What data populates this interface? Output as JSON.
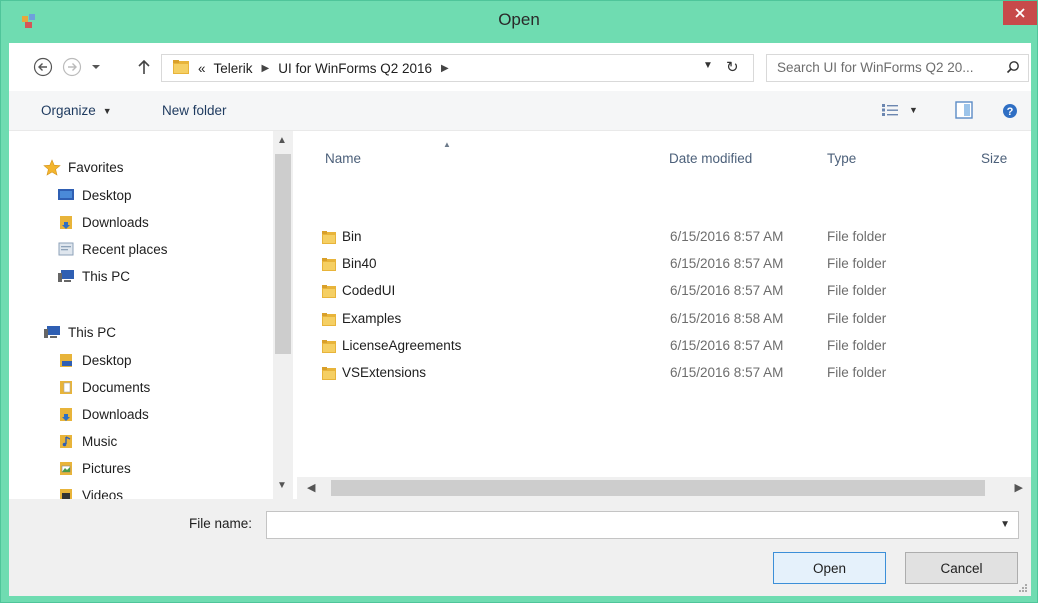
{
  "window": {
    "title": "Open",
    "colors": {
      "frame": "#6fdcb1",
      "close": "#c74a4a"
    }
  },
  "address": {
    "overflow": "«",
    "crumbs": [
      "Telerik",
      "UI for WinForms Q2 2016"
    ]
  },
  "search": {
    "placeholder": "Search UI for WinForms Q2 20..."
  },
  "toolbar": {
    "organize": "Organize",
    "new_folder": "New folder"
  },
  "nav": {
    "favorites": {
      "label": "Favorites",
      "items": [
        "Desktop",
        "Downloads",
        "Recent places",
        "This PC"
      ]
    },
    "this_pc": {
      "label": "This PC",
      "items": [
        "Desktop",
        "Documents",
        "Downloads",
        "Music",
        "Pictures",
        "Videos"
      ]
    }
  },
  "columns": {
    "name": "Name",
    "date": "Date modified",
    "type": "Type",
    "size": "Size"
  },
  "files": [
    {
      "name": "Bin",
      "date": "6/15/2016 8:57 AM",
      "type": "File folder"
    },
    {
      "name": "Bin40",
      "date": "6/15/2016 8:57 AM",
      "type": "File folder"
    },
    {
      "name": "CodedUI",
      "date": "6/15/2016 8:57 AM",
      "type": "File folder"
    },
    {
      "name": "Examples",
      "date": "6/15/2016 8:58 AM",
      "type": "File folder"
    },
    {
      "name": "LicenseAgreements",
      "date": "6/15/2016 8:57 AM",
      "type": "File folder"
    },
    {
      "name": "VSExtensions",
      "date": "6/15/2016 8:57 AM",
      "type": "File folder"
    }
  ],
  "bottom": {
    "file_name_label": "File name:",
    "file_name_value": "",
    "open_button": "Open",
    "cancel_button": "Cancel"
  }
}
